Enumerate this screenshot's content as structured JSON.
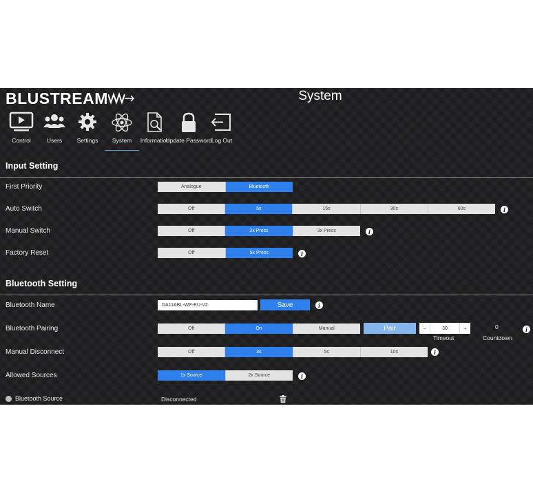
{
  "brand": {
    "logo_text": "BLUSTREAM",
    "accent": "#2f80ed"
  },
  "page_title": "System",
  "nav": [
    {
      "label": "Control",
      "icon": "monitor-play-icon"
    },
    {
      "label": "Users",
      "icon": "users-icon"
    },
    {
      "label": "Settings",
      "icon": "gear-icon"
    },
    {
      "label": "System",
      "icon": "atom-icon",
      "active": true
    },
    {
      "label": "Information",
      "icon": "document-search-icon"
    },
    {
      "label": "Update Password",
      "icon": "lock-icon"
    },
    {
      "label": "Log Out",
      "icon": "logout-icon"
    }
  ],
  "input_setting": {
    "title": "Input Setting",
    "first_priority": {
      "label": "First Priority",
      "options": [
        "Analogue",
        "Bluetooth"
      ],
      "selected": "Bluetooth"
    },
    "auto_switch": {
      "label": "Auto Switch",
      "options": [
        "Off",
        "5s",
        "15s",
        "30s",
        "60s"
      ],
      "selected": "5s"
    },
    "manual_switch": {
      "label": "Manual Switch",
      "options": [
        "Off",
        "2x Press",
        "3x Press"
      ],
      "selected": "2x Press"
    },
    "factory_reset": {
      "label": "Factory Reset",
      "options": [
        "Off",
        "5x Press"
      ],
      "selected": "5x Press"
    }
  },
  "bluetooth_setting": {
    "title": "Bluetooth Setting",
    "name": {
      "label": "Bluetooth Name",
      "value": "DA11ABL-WP-EU-V2",
      "save_label": "Save"
    },
    "pairing": {
      "label": "Bluetooth Pairing",
      "options": [
        "Off",
        "On",
        "Manual"
      ],
      "selected": "On",
      "pair_label": "Pair",
      "timeout_value": "30",
      "timeout_label": "Timeout",
      "countdown_value": "0",
      "countdown_label": "Countdown",
      "minus": "−",
      "plus": "+"
    },
    "manual_disconnect": {
      "label": "Manual Disconnect",
      "options": [
        "Off",
        "3s",
        "5s",
        "10s"
      ],
      "selected": "3s"
    },
    "allowed_sources": {
      "label": "Allowed Sources",
      "options": [
        "1x Source",
        "2x Source"
      ],
      "selected": "1x Source"
    },
    "source": {
      "label": "Bluetooth Source",
      "status": "Disconnected",
      "delete_icon": "trash-icon"
    }
  },
  "info_glyph": "i"
}
